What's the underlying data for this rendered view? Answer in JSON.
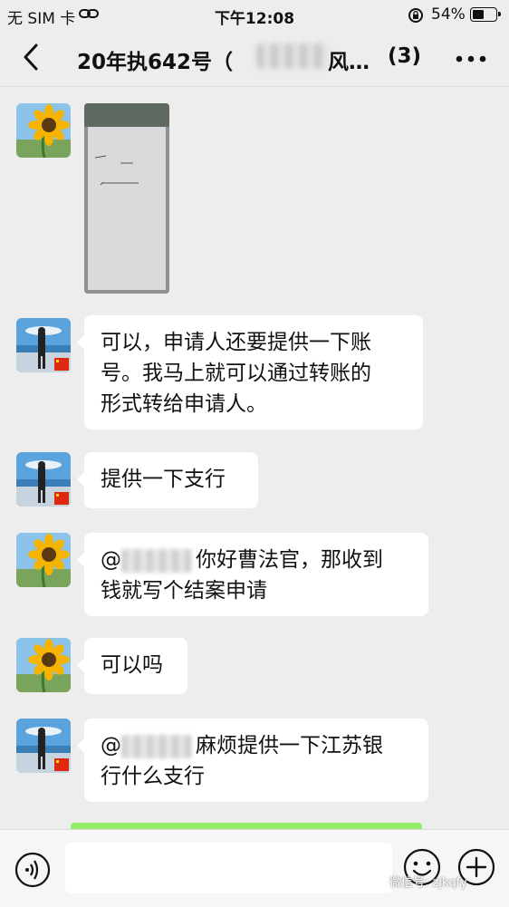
{
  "status_bar": {
    "carrier": "无 SIM 卡",
    "time": "下午12:08",
    "battery_percent": "54%",
    "battery_level": 0.54
  },
  "nav": {
    "title": "20年执642号（",
    "title_suffix": "风…",
    "member_count": "(3)"
  },
  "messages": [
    {
      "sender": "sunflower",
      "type": "image"
    },
    {
      "sender": "person",
      "type": "text",
      "lines": [
        "可以，申请人还要提供一下账",
        "号。我马上就可以通过转账的",
        "形式转给申请人。"
      ]
    },
    {
      "sender": "person",
      "type": "text",
      "lines": [
        "提供一下支行"
      ]
    },
    {
      "sender": "sunflower",
      "type": "text",
      "mention": "@",
      "lines": [
        "你好曹法官，那收到",
        "钱就写个结案申请"
      ]
    },
    {
      "sender": "sunflower",
      "type": "text",
      "lines": [
        "可以吗"
      ]
    },
    {
      "sender": "person",
      "type": "text",
      "mention": "@",
      "lines": [
        "麻烦提供一下江苏银",
        "行什么支行"
      ]
    }
  ],
  "input_bar": {
    "placeholder": ""
  },
  "watermark": "微信号: zjkqfy",
  "colors": {
    "background": "#ededed",
    "bubble": "#ffffff",
    "green_bubble": "#95ec69"
  },
  "icons": [
    "back-icon",
    "more-icon",
    "voice-icon",
    "emoji-icon",
    "plus-icon",
    "link-icon",
    "lock-rotation-icon",
    "battery-icon"
  ]
}
